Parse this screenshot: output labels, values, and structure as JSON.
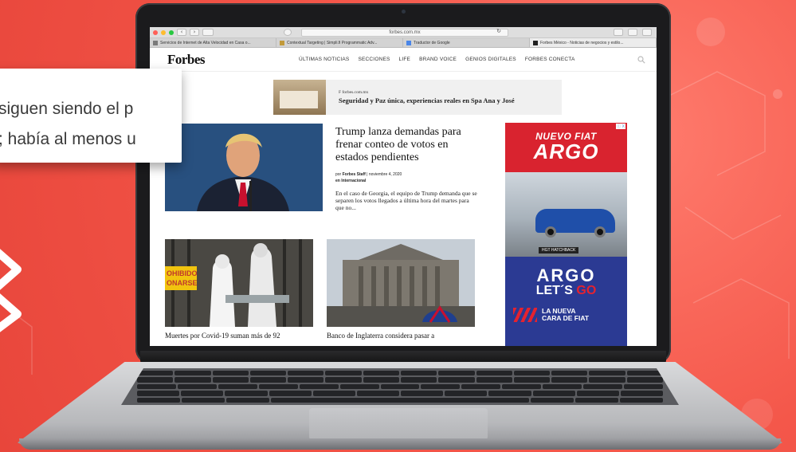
{
  "zoom_card": {
    "line1": "siguen siendo el p",
    "line2": "; había al menos u"
  },
  "browser": {
    "address": "forbes.com.mx",
    "tabs": [
      {
        "label": "Servicios de Internet de Alta Velocidad en Casa o..."
      },
      {
        "label": "Contextual Targeting | Simpli.fi Programmatic Adv..."
      },
      {
        "label": "Traductor de Google"
      },
      {
        "label": "Forbes México - Noticias de negocios y estilo..."
      }
    ],
    "nav_back": "‹",
    "nav_fwd": "›"
  },
  "site": {
    "logo": "Forbes",
    "menu": [
      "ÚLTIMAS NOTICIAS",
      "SECCIONES",
      "LIFE",
      "BRAND VOICE",
      "GENIOS DIGITALES",
      "FORBES CONECTA"
    ]
  },
  "promo": {
    "source": "F forbes.com.mx",
    "title": "Seguridad y Paz única, experiencias reales en Spa Ana y José"
  },
  "hero": {
    "title": "Trump lanza demandas para frenar conteo de votos en estados pendientes",
    "byline_prefix": "por",
    "author": "Forbes Staff",
    "date": "noviembre 4, 2020",
    "category": "en Internacional",
    "excerpt": "En el caso de Georgia, el equipo de Trump demanda que se separen los votos llegados a última hora del martes para que no..."
  },
  "cards": [
    {
      "title": "Muertes por Covid-19 suman más de 92",
      "sign_line1": "OHIBIDO",
      "sign_line2": "ONARSE"
    },
    {
      "title": "Banco de Inglaterra considera pasar a"
    }
  ],
  "ad": {
    "nuevo": "NUEVO FIAT",
    "argo": "ARGO",
    "badge": "HGT HATCHBACK",
    "argo2": "ARGO",
    "lets": "LET´S",
    "go": "GO",
    "nueva_line1": "LA NUEVA",
    "nueva_line2": "CARA DE FIAT",
    "adchoice": "ⓘ X"
  },
  "colors": {
    "background": "#f4574a",
    "ad_red": "#d9232f",
    "ad_blue": "#2b3a93"
  }
}
